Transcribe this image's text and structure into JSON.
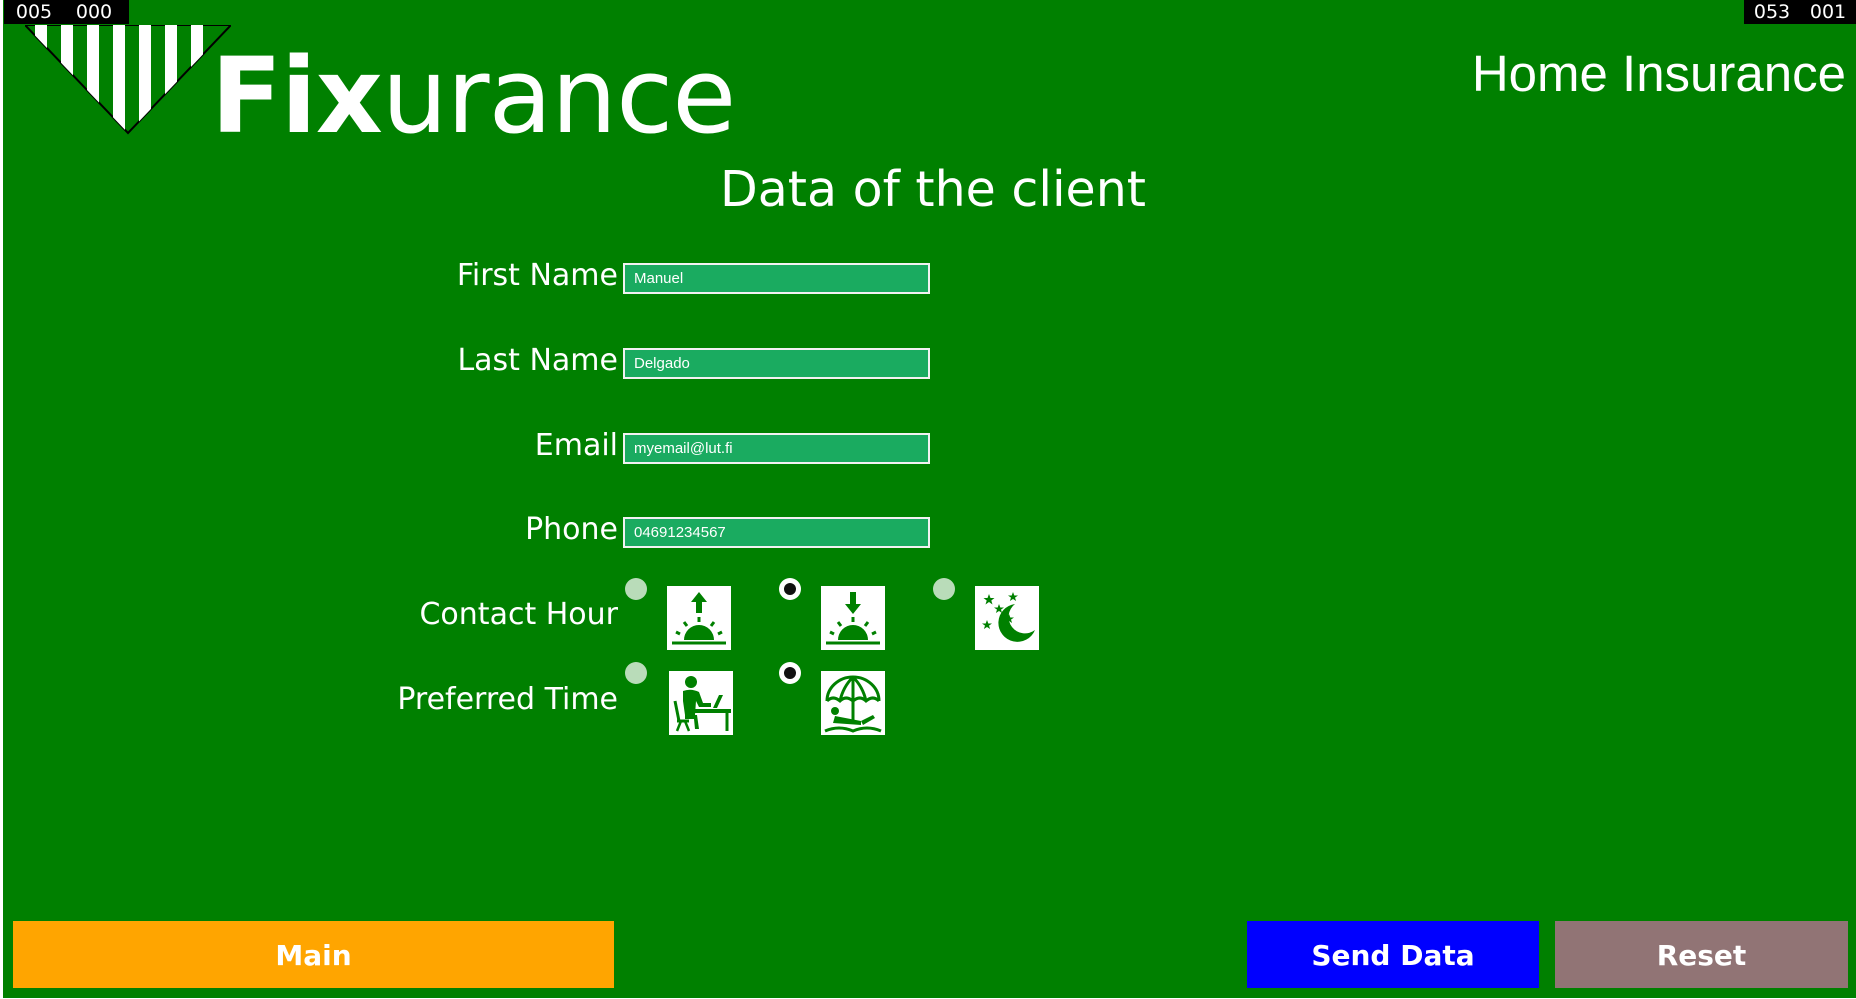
{
  "counters": {
    "left": [
      "005",
      "000"
    ],
    "right": [
      "053",
      "001"
    ]
  },
  "brand": {
    "name_strong": "Fix",
    "name_light": "urance"
  },
  "page_heading": "Home Insurance",
  "form_title": "Data of the client",
  "fields": {
    "first_name": {
      "label": "First Name",
      "value": "Manuel"
    },
    "last_name": {
      "label": "Last Name",
      "value": "Delgado"
    },
    "email": {
      "label": "Email",
      "value": "myemail@lut.fi"
    },
    "phone": {
      "label": "Phone",
      "value": "04691234567"
    }
  },
  "contact_hour": {
    "label": "Contact Hour",
    "options": [
      {
        "icon": "sunrise-icon",
        "selected": false
      },
      {
        "icon": "sunset-icon",
        "selected": true
      },
      {
        "icon": "moon-stars-icon",
        "selected": false
      }
    ]
  },
  "preferred_time": {
    "label": "Preferred Time",
    "options": [
      {
        "icon": "office-worker-icon",
        "selected": false
      },
      {
        "icon": "beach-umbrella-icon",
        "selected": true
      }
    ]
  },
  "buttons": {
    "main": "Main",
    "send": "Send Data",
    "reset": "Reset"
  },
  "colors": {
    "background": "#008000",
    "input_bg": "#1aab60",
    "main_button": "#ffa500",
    "send_button": "#0000ff",
    "reset_button": "#917475"
  }
}
